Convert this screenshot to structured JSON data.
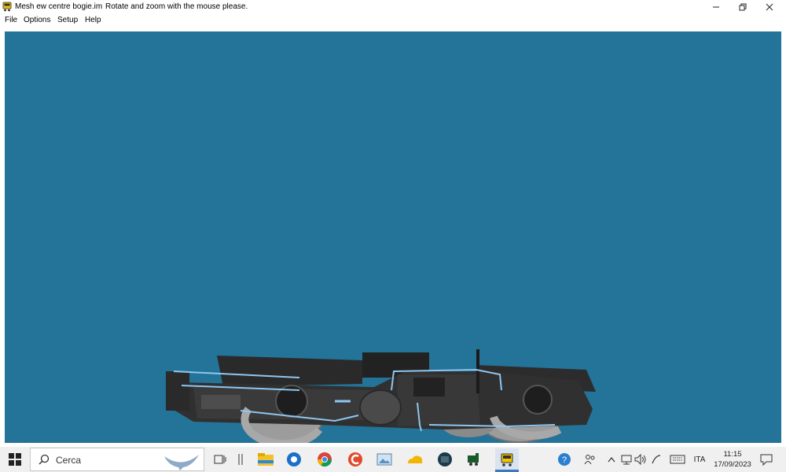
{
  "window": {
    "title": "Mesh ew centre bogie.im",
    "hint": "Rotate and zoom with the mouse please.",
    "controls": [
      "minimize",
      "restore",
      "close"
    ]
  },
  "menu": [
    "File",
    "Options",
    "Setup",
    "Help"
  ],
  "viewport": {
    "background": "#247399",
    "content": "3D model of a railway bogie"
  },
  "taskbar": {
    "search_placeholder": "Cerca",
    "pinned_icons": [
      "manta-ray-icon",
      "task-view-icon",
      "separator-icon",
      "file-explorer-icon",
      "browser-icon",
      "chrome-icon",
      "ccleaner-icon",
      "photos-icon",
      "cloud-icon",
      "steam-locomotive-icon",
      "train-sim-icon",
      "bogie-app-icon"
    ],
    "tray": {
      "language": "ITA",
      "time": "11:15",
      "date": "17/09/2023"
    }
  }
}
